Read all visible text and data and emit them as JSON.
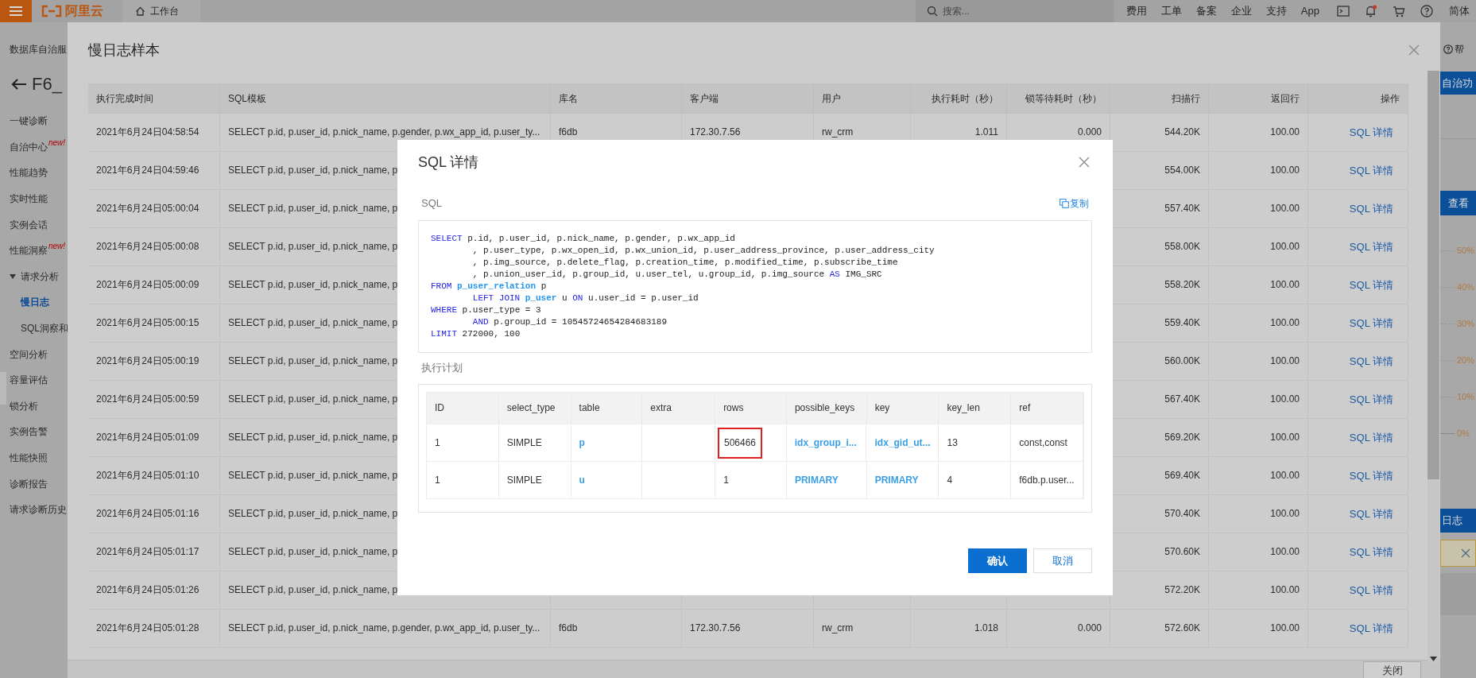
{
  "top_bar": {
    "logo": "阿里云",
    "workbench": "工作台",
    "search": {
      "placeholder": "搜索..."
    },
    "links": [
      "费用",
      "工单",
      "备案",
      "企业",
      "支持",
      "App"
    ],
    "language": "简体"
  },
  "sidebar": {
    "service": "数据库自治服",
    "instance": "F6_",
    "items": [
      {
        "label": "一键诊断",
        "selected": false
      },
      {
        "label": "自治中心",
        "badge": "new!",
        "selected": false
      },
      {
        "label": "性能趋势",
        "selected": false
      },
      {
        "label": "实时性能",
        "selected": false
      },
      {
        "label": "实例会话",
        "selected": false
      },
      {
        "label": "性能洞察",
        "badge": "new!",
        "selected": false
      },
      {
        "label": "请求分析",
        "selected": false,
        "expanded": true,
        "children": [
          {
            "label": "慢日志",
            "selected": true
          },
          {
            "label": "SQL洞察和",
            "selected": false
          }
        ]
      },
      {
        "label": "空间分析",
        "selected": false
      },
      {
        "label": "容量评估",
        "selected": false
      },
      {
        "label": "锁分析",
        "selected": false
      },
      {
        "label": "实例告警",
        "selected": false
      },
      {
        "label": "性能快照",
        "selected": false
      },
      {
        "label": "诊断报告",
        "selected": false
      },
      {
        "label": "请求诊断历史",
        "selected": false
      }
    ]
  },
  "right_panel": {
    "help": "帮",
    "function_bar": "自治功",
    "view_button": "查看",
    "axis_labels": [
      "50%",
      "40%",
      "30%",
      "20%",
      "10%",
      "0%"
    ],
    "log_button": "日志"
  },
  "slow_log_dialog": {
    "title": "慢日志样本",
    "columns": [
      "执行完成时间",
      "SQL模板",
      "库名",
      "客户端",
      "用户",
      "执行耗时（秒）",
      "锁等待耗时（秒）",
      "扫描行",
      "返回行",
      "操作"
    ],
    "rows": [
      {
        "time": "2021年6月24日04:58:54",
        "sql": "SELECT p.id, p.user_id, p.nick_name, p.gender, p.wx_app_id, p.user_ty...",
        "database": "f6db",
        "client": "172.30.7.56",
        "user": "rw_crm",
        "duration": "1.011",
        "lock_wait": "0.000",
        "scanned": "544.20K",
        "returned": "100.00",
        "action": "SQL 详情"
      },
      {
        "time": "2021年6月24日04:59:46",
        "sql": "SELECT p.id, p.user_id, p.nick_name, p",
        "scanned": "554.00K",
        "returned": "100.00",
        "action": "SQL 详情"
      },
      {
        "time": "2021年6月24日05:00:04",
        "sql": "SELECT p.id, p.user_id, p.nick_name, p",
        "scanned": "557.40K",
        "returned": "100.00",
        "action": "SQL 详情"
      },
      {
        "time": "2021年6月24日05:00:08",
        "sql": "SELECT p.id, p.user_id, p.nick_name, p",
        "scanned": "558.00K",
        "returned": "100.00",
        "action": "SQL 详情"
      },
      {
        "time": "2021年6月24日05:00:09",
        "sql": "SELECT p.id, p.user_id, p.nick_name, p",
        "scanned": "558.20K",
        "returned": "100.00",
        "action": "SQL 详情"
      },
      {
        "time": "2021年6月24日05:00:15",
        "sql": "SELECT p.id, p.user_id, p.nick_name, p",
        "scanned": "559.40K",
        "returned": "100.00",
        "action": "SQL 详情"
      },
      {
        "time": "2021年6月24日05:00:19",
        "sql": "SELECT p.id, p.user_id, p.nick_name, p",
        "scanned": "560.00K",
        "returned": "100.00",
        "action": "SQL 详情"
      },
      {
        "time": "2021年6月24日05:00:59",
        "sql": "SELECT p.id, p.user_id, p.nick_name, p",
        "scanned": "567.40K",
        "returned": "100.00",
        "action": "SQL 详情"
      },
      {
        "time": "2021年6月24日05:01:09",
        "sql": "SELECT p.id, p.user_id, p.nick_name, p",
        "scanned": "569.20K",
        "returned": "100.00",
        "action": "SQL 详情"
      },
      {
        "time": "2021年6月24日05:01:10",
        "sql": "SELECT p.id, p.user_id, p.nick_name, p",
        "scanned": "569.40K",
        "returned": "100.00",
        "action": "SQL 详情"
      },
      {
        "time": "2021年6月24日05:01:16",
        "sql": "SELECT p.id, p.user_id, p.nick_name, p",
        "scanned": "570.40K",
        "returned": "100.00",
        "action": "SQL 详情"
      },
      {
        "time": "2021年6月24日05:01:17",
        "sql": "SELECT p.id, p.user_id, p.nick_name, p",
        "scanned": "570.60K",
        "returned": "100.00",
        "action": "SQL 详情"
      },
      {
        "time": "2021年6月24日05:01:26",
        "sql": "SELECT p.id, p.user_id, p.nick_name, p",
        "scanned": "572.20K",
        "returned": "100.00",
        "action": "SQL 详情"
      },
      {
        "time": "2021年6月24日05:01:28",
        "sql": "SELECT p.id, p.user_id, p.nick_name, p.gender, p.wx_app_id, p.user_ty...",
        "database": "f6db",
        "client": "172.30.7.56",
        "user": "rw_crm",
        "duration": "1.018",
        "lock_wait": "0.000",
        "scanned": "572.60K",
        "returned": "100.00",
        "action": "SQL 详情"
      }
    ],
    "close_button": "关闭"
  },
  "sql_detail_modal": {
    "title": "SQL 详情",
    "sql_label": "SQL",
    "copy_link": "复制",
    "sql_lines": [
      [
        {
          "kind": "keyword",
          "text": "SELECT"
        },
        {
          "kind": "plain",
          "text": " p.id, p.user_id, p.nick_name, p.gender, p.wx_app_id"
        }
      ],
      [
        {
          "kind": "plain",
          "text": "        , p.user_type, p.wx_open_id, p.wx_union_id, p.user_address_province, p.user_address_city"
        }
      ],
      [
        {
          "kind": "plain",
          "text": "        , p.img_source, p.delete_flag, p.creation_time, p.modified_time, p.subscribe_time"
        }
      ],
      [
        {
          "kind": "plain",
          "text": "        , p.union_user_id, p.group_id, u.user_tel, u.group_id, p.img_source "
        },
        {
          "kind": "keyword",
          "text": "AS"
        },
        {
          "kind": "plain",
          "text": " IMG_SRC"
        }
      ],
      [
        {
          "kind": "keyword",
          "text": "FROM"
        },
        {
          "kind": "table",
          "text": " p_user_relation"
        },
        {
          "kind": "plain",
          "text": " p"
        }
      ],
      [
        {
          "kind": "keyword",
          "text": "        LEFT JOIN"
        },
        {
          "kind": "table",
          "text": " p_user"
        },
        {
          "kind": "plain",
          "text": " u "
        },
        {
          "kind": "keyword",
          "text": "ON"
        },
        {
          "kind": "plain",
          "text": " u.user_id = p.user_id"
        }
      ],
      [
        {
          "kind": "keyword",
          "text": "WHERE"
        },
        {
          "kind": "plain",
          "text": " p.user_type = 3"
        }
      ],
      [
        {
          "kind": "keyword",
          "text": "        AND"
        },
        {
          "kind": "plain",
          "text": " p.group_id = 10545724654284683189"
        }
      ],
      [
        {
          "kind": "keyword",
          "text": "LIMIT"
        },
        {
          "kind": "plain",
          "text": " 272000, 100"
        }
      ]
    ],
    "plan_label": "执行计划",
    "plan_columns": [
      {
        "label": "ID",
        "kind": "text"
      },
      {
        "label": "select_type",
        "kind": "text"
      },
      {
        "label": "table",
        "kind": "link"
      },
      {
        "label": "extra"
      },
      {
        "label": "rows",
        "kind": "text"
      },
      {
        "label": "possible_keys",
        "kind": "link"
      },
      {
        "label": "key",
        "kind": "link"
      },
      {
        "label": "key_len",
        "kind": "text"
      },
      {
        "label": "ref",
        "kind": "text"
      }
    ],
    "plan_rows": [
      {
        "id": "1",
        "select_type": "SIMPLE",
        "table": "p",
        "rows": "506466",
        "possible_keys": "idx_group_i...",
        "key": "idx_gid_ut...",
        "key_len": "13",
        "ref": "const,const",
        "rows_highlighted": true
      },
      {
        "id": "1",
        "select_type": "SIMPLE",
        "table": "u",
        "rows": "1",
        "possible_keys": "PRIMARY",
        "key": "PRIMARY",
        "key_len": "4",
        "ref": "f6db.p.user...",
        "rows_highlighted": false
      }
    ],
    "buttons": [
      {
        "label": "确认",
        "kind": "primary"
      },
      {
        "label": "取消",
        "kind": "secondary"
      }
    ]
  }
}
